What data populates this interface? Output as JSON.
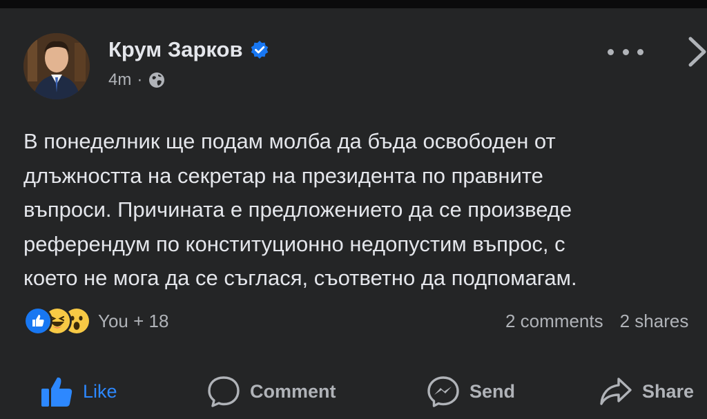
{
  "post": {
    "author": "Крум Зарков",
    "time": "4m",
    "separator": "·",
    "lines": [
      "В понеделник ще подам молба да бъда освободен от",
      "длъжността на секретар на президента по правните",
      "въпроси. Причината е предложението да се произведе",
      "референдум по конституционно недопустим въпрос, с",
      "което не мога да се съглася, съответно да подпомагам."
    ]
  },
  "reactions": {
    "icons": [
      "like-reaction-icon",
      "haha-reaction-icon",
      "wow-reaction-icon"
    ],
    "count_label": "You + 18"
  },
  "stats": {
    "comments": "2 comments",
    "shares": "2 shares"
  },
  "actions": {
    "like": "Like",
    "comment": "Comment",
    "send": "Send",
    "share": "Share"
  },
  "colors": {
    "background": "#242526",
    "text": "#e4e6eb",
    "muted": "#b0b3b8",
    "accent": "#2d88ff",
    "verified": "#1877f2"
  }
}
